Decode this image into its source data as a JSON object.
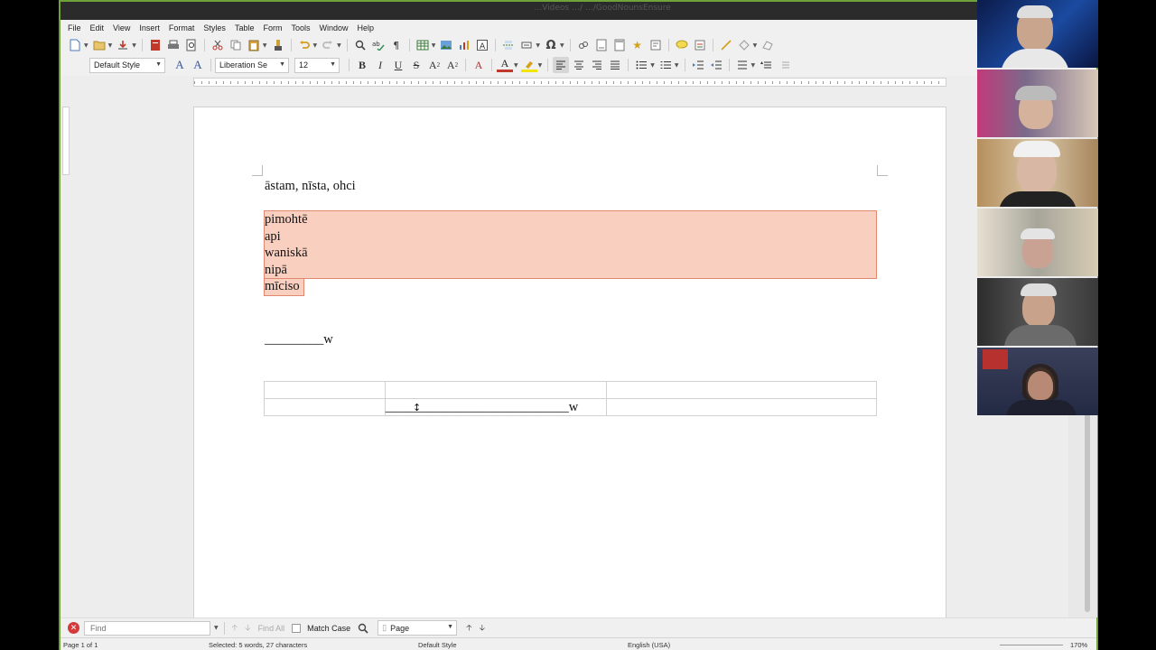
{
  "window": {
    "title": "…Videos …/ …/GoodNounsEnsure"
  },
  "menubar": {
    "items": [
      "File",
      "Edit",
      "View",
      "Insert",
      "Format",
      "Styles",
      "Table",
      "Form",
      "Tools",
      "Window",
      "Help"
    ]
  },
  "toolbar2": {
    "paragraph_style": "Default Style",
    "font_name": "Liberation Se",
    "font_size": "12"
  },
  "document": {
    "heading_line": "āstam, nīsta, ohci",
    "highlighted_words": [
      "pimohtē",
      "api",
      "waniskā",
      "nipā",
      "mīciso"
    ],
    "blank_line": "_________w",
    "table": {
      "rows": [
        [
          "",
          "",
          ""
        ],
        [
          "",
          "____________________________w",
          ""
        ]
      ]
    }
  },
  "findbar": {
    "placeholder": "Find",
    "find_all": "Find All",
    "match_case": "Match Case",
    "search_scope": "Page"
  },
  "statusbar": {
    "page": "Page 1 of 1",
    "selection": "Selected: 5 words, 27 characters",
    "page_style": "Default Style",
    "language": "English (USA)",
    "zoom": "170%"
  },
  "colors": {
    "highlight_fill": "#f9cfc0",
    "highlight_border": "#e08870",
    "window_border": "#6fa23a",
    "close_red": "#d43a3a"
  },
  "video_participants": 6
}
